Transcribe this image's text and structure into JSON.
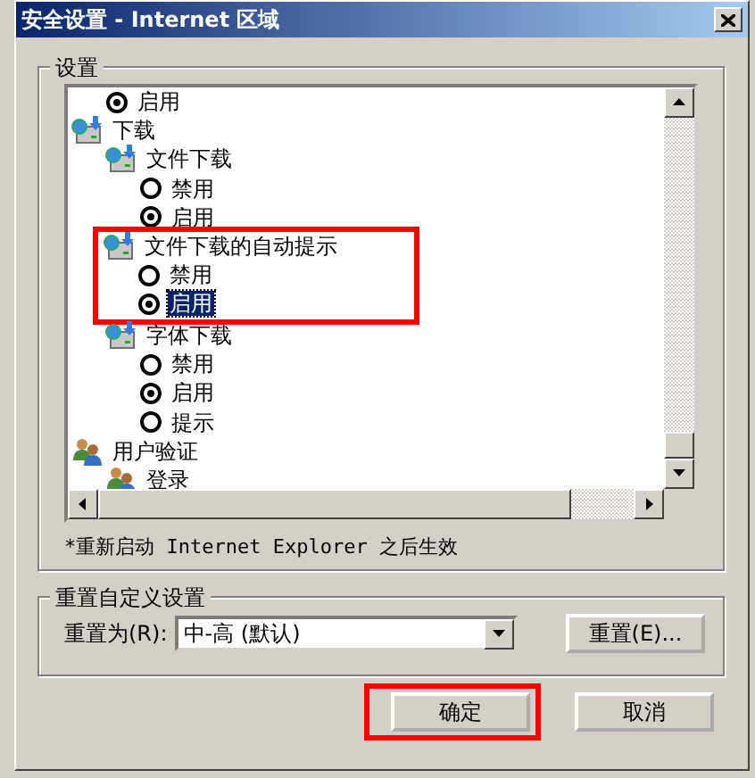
{
  "window": {
    "title": "安全设置 - Internet 区域"
  },
  "settings": {
    "title": "设置",
    "tree": [
      {
        "kind": "continued",
        "children": [
          {
            "kind": "option",
            "label": "启用",
            "checked": true,
            "selected": false
          }
        ]
      },
      {
        "kind": "download",
        "label": "下载",
        "children": [
          {
            "kind": "download",
            "label": "文件下载",
            "children": [
              {
                "kind": "option",
                "label": "禁用",
                "checked": false,
                "selected": false
              },
              {
                "kind": "option",
                "label": "启用",
                "checked": true,
                "selected": false
              }
            ]
          },
          {
            "kind": "download",
            "label": "文件下载的自动提示",
            "highlighted": true,
            "children": [
              {
                "kind": "option",
                "label": "禁用",
                "checked": false,
                "selected": false
              },
              {
                "kind": "option",
                "label": "启用",
                "checked": true,
                "selected": true
              }
            ]
          },
          {
            "kind": "download",
            "label": "字体下载",
            "children": [
              {
                "kind": "option",
                "label": "禁用",
                "checked": false,
                "selected": false
              },
              {
                "kind": "option",
                "label": "启用",
                "checked": true,
                "selected": false
              },
              {
                "kind": "option",
                "label": "提示",
                "checked": false,
                "selected": false
              }
            ]
          }
        ]
      },
      {
        "kind": "users",
        "label": "用户验证",
        "children": [
          {
            "kind": "users",
            "label": "登录"
          }
        ]
      }
    ],
    "note": "*重新启动 Internet Explorer 之后生效"
  },
  "reset": {
    "title": "重置自定义设置",
    "label": "重置为(R):",
    "value": "中-高 (默认)",
    "button": "重置(E)..."
  },
  "buttons": [
    {
      "label": "确定",
      "highlighted": true
    },
    {
      "label": "取消",
      "highlighted": false
    }
  ]
}
